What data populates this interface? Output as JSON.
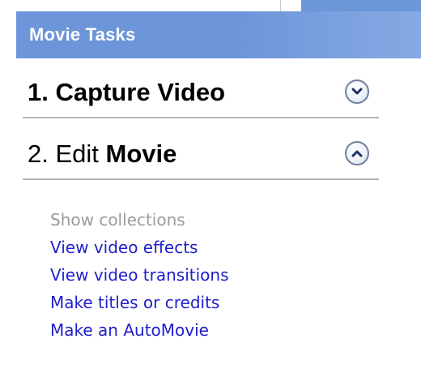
{
  "pane": {
    "title": "Movie Tasks"
  },
  "sections": [
    {
      "number": "1.",
      "title": "Capture Video",
      "state": "collapsed",
      "chevron_icon": "chevron-down-icon"
    },
    {
      "number": "2.",
      "title": "Edit Movie",
      "state": "expanded",
      "chevron_icon": "chevron-up-icon"
    }
  ],
  "tasks": [
    {
      "label": "Show collections",
      "enabled": false
    },
    {
      "label": "View video effects",
      "enabled": true
    },
    {
      "label": "View video transitions",
      "enabled": true
    },
    {
      "label": "Make titles or credits",
      "enabled": true
    },
    {
      "label": "Make an AutoMovie",
      "enabled": true
    }
  ],
  "colors": {
    "header_bg": "#6d96da",
    "header_text": "#ffffff",
    "link": "#2020cc",
    "disabled": "#9b9b9b",
    "rule": "#b7b7b0"
  }
}
